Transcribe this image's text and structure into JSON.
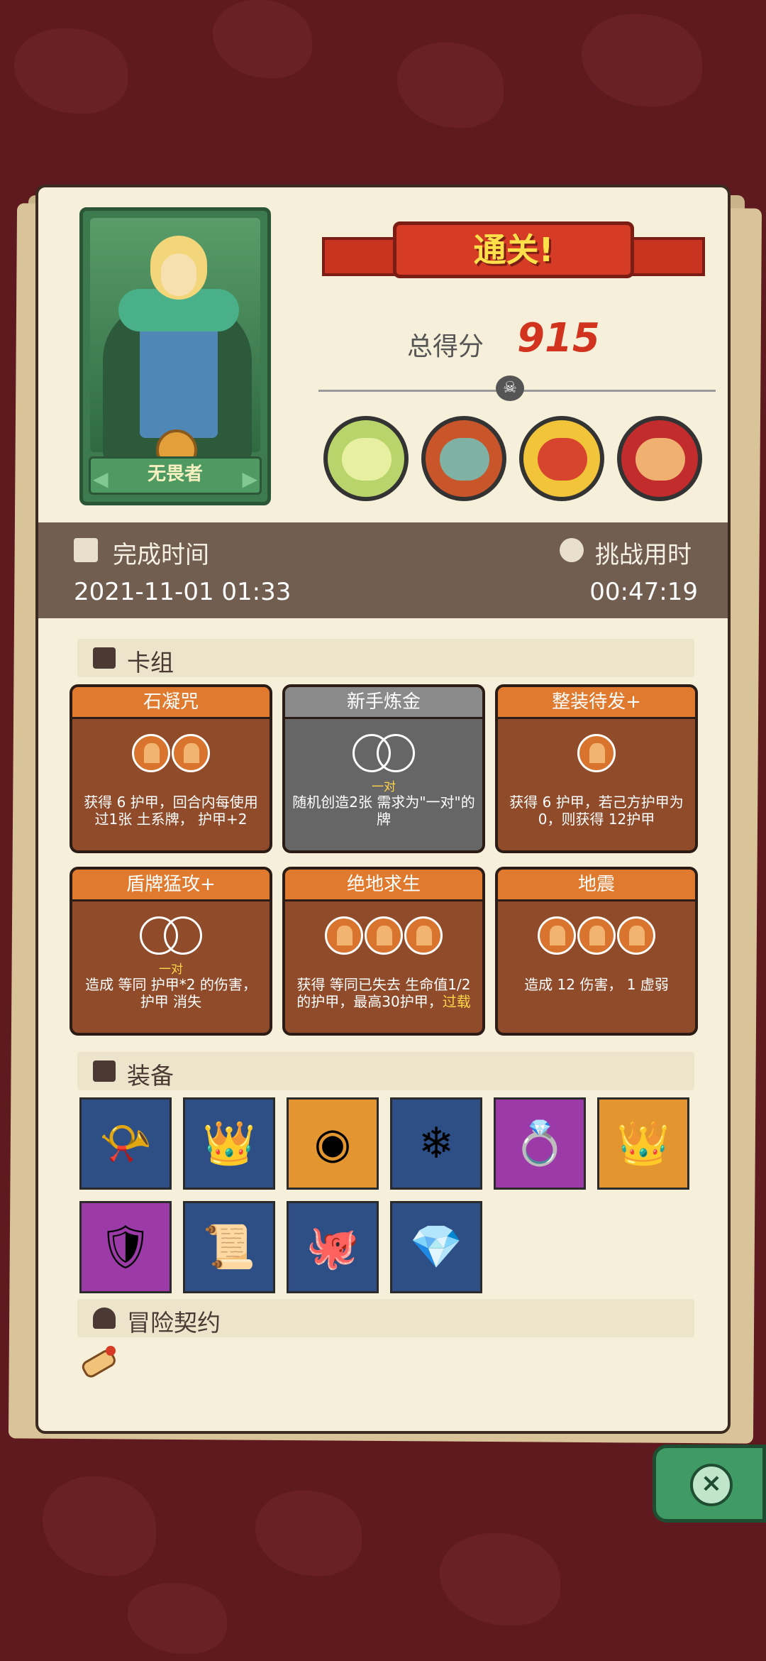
{
  "hero": {
    "name": "无畏者"
  },
  "result": {
    "banner": "通关!",
    "score_label": "总得分",
    "score": "915"
  },
  "time": {
    "completed_label": "完成时间",
    "completed_value": "2021-11-01 01:33",
    "duration_label": "挑战用时",
    "duration_value": "00:47:19"
  },
  "deck": {
    "title": "卡组",
    "cards": [
      {
        "name": "石凝咒",
        "desc": "获得 6 护甲，回合内每使用过1张 土系牌， 护甲+2"
      },
      {
        "name": "新手炼金",
        "pair": "一对",
        "desc": "随机创造2张 需求为\"一对\"的牌"
      },
      {
        "name": "整装待发+",
        "desc": "获得 6 护甲，若己方护甲为0，则获得 12护甲"
      },
      {
        "name": "盾牌猛攻+",
        "pair": "一对",
        "desc": "造成 等同 护甲*2 的伤害， 护甲 消失"
      },
      {
        "name": "绝地求生",
        "desc": "获得 等同已失去 生命值1/2 的护甲，最高30护甲，",
        "keyword": "过载"
      },
      {
        "name": "地震",
        "desc": "造成 12 伤害， 1 虚弱"
      }
    ]
  },
  "equipment": {
    "title": "装备",
    "items": [
      {
        "icon": "horn-icon",
        "color": "#2d4f86"
      },
      {
        "icon": "ice-crown-icon",
        "color": "#2d4f86"
      },
      {
        "icon": "ram-horn-icon",
        "color": "#e3962f"
      },
      {
        "icon": "snowflake-emblem-icon",
        "color": "#2d4f86"
      },
      {
        "icon": "emerald-ring-icon",
        "color": "#9c3aa8"
      },
      {
        "icon": "gold-crown-icon",
        "color": "#e3962f"
      },
      {
        "icon": "armor-vest-icon",
        "color": "#9c3aa8"
      },
      {
        "icon": "frost-scroll-icon",
        "color": "#2d4f86"
      },
      {
        "icon": "cthulhu-cloak-icon",
        "color": "#2d4f86"
      },
      {
        "icon": "crystal-dice-icon",
        "color": "#2d4f86"
      }
    ]
  },
  "contract": {
    "title": "冒险契约"
  }
}
